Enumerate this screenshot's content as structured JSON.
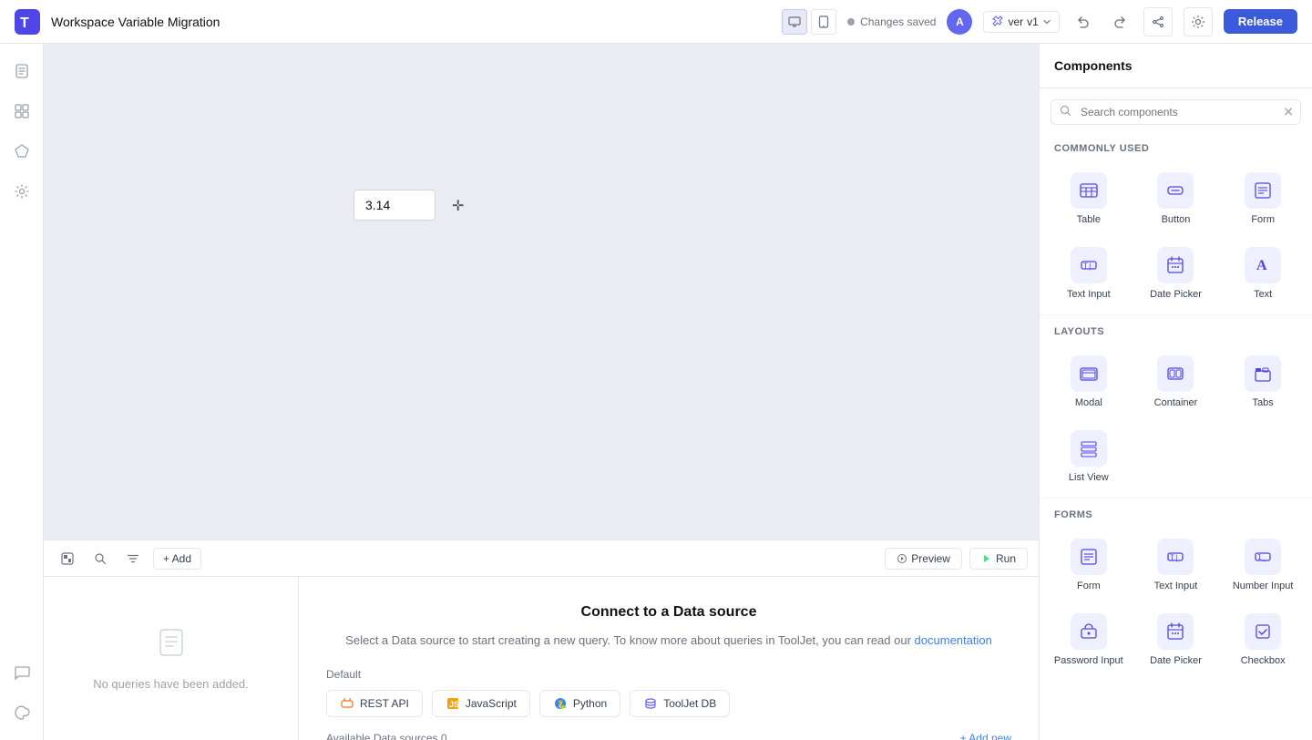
{
  "topbar": {
    "title": "Workspace Variable Migration",
    "view_toggle": [
      "desktop",
      "tablet"
    ],
    "status": "Changes saved",
    "avatar_initial": "A",
    "version_label": "ver",
    "version_number": "v1",
    "undo_label": "Undo",
    "redo_label": "Redo",
    "share_label": "Share",
    "settings_label": "Settings",
    "release_label": "Release"
  },
  "sidebar": {
    "items": [
      {
        "name": "pages",
        "icon": "📄"
      },
      {
        "name": "components",
        "icon": "🧩"
      },
      {
        "name": "queries",
        "icon": "⚡"
      },
      {
        "name": "settings",
        "icon": "⚙️"
      }
    ],
    "bottom_items": [
      {
        "name": "chat",
        "icon": "💬"
      },
      {
        "name": "theme",
        "icon": "🌙"
      }
    ]
  },
  "canvas": {
    "widget_value": "3.14"
  },
  "bottom_panel": {
    "toolbar": {
      "minimap_label": "Minimap",
      "search_label": "Search",
      "filter_label": "Filter",
      "add_label": "+ Add",
      "preview_label": "Preview",
      "run_label": "Run"
    },
    "query_empty_text": "No queries have been added.",
    "datasource": {
      "title": "Connect to a Data source",
      "description": "Select a Data source to start creating a new query. To know more about queries in ToolJet, you can read our",
      "docs_link": "documentation",
      "default_label": "Default",
      "options": [
        {
          "label": "REST API",
          "icon": "🔗"
        },
        {
          "label": "JavaScript",
          "icon": "JS"
        },
        {
          "label": "Python",
          "icon": "🐍"
        },
        {
          "label": "ToolJet DB",
          "icon": "🗄️"
        }
      ],
      "available_label": "Available Data sources",
      "available_count": "0",
      "add_new_label": "+ Add new"
    }
  },
  "right_panel": {
    "title": "Components",
    "search_placeholder": "Search components",
    "sections": [
      {
        "label": "Commonly Used",
        "items": [
          {
            "name": "Table",
            "icon": "table"
          },
          {
            "name": "Button",
            "icon": "button"
          },
          {
            "name": "Form",
            "icon": "form"
          },
          {
            "name": "Text Input",
            "icon": "text-input"
          },
          {
            "name": "Date Picker",
            "icon": "date-picker"
          },
          {
            "name": "Text",
            "icon": "text"
          }
        ]
      },
      {
        "label": "Layouts",
        "items": [
          {
            "name": "Modal",
            "icon": "modal"
          },
          {
            "name": "Container",
            "icon": "container"
          },
          {
            "name": "Tabs",
            "icon": "tabs"
          },
          {
            "name": "List View",
            "icon": "list-view"
          }
        ]
      },
      {
        "label": "Forms",
        "items": [
          {
            "name": "Form",
            "icon": "form"
          },
          {
            "name": "Text Input",
            "icon": "text-input"
          },
          {
            "name": "Number Input",
            "icon": "number-input"
          },
          {
            "name": "Password Input",
            "icon": "password-input"
          },
          {
            "name": "Date Picker",
            "icon": "date-picker"
          },
          {
            "name": "Checkbox",
            "icon": "checkbox"
          }
        ]
      }
    ]
  }
}
